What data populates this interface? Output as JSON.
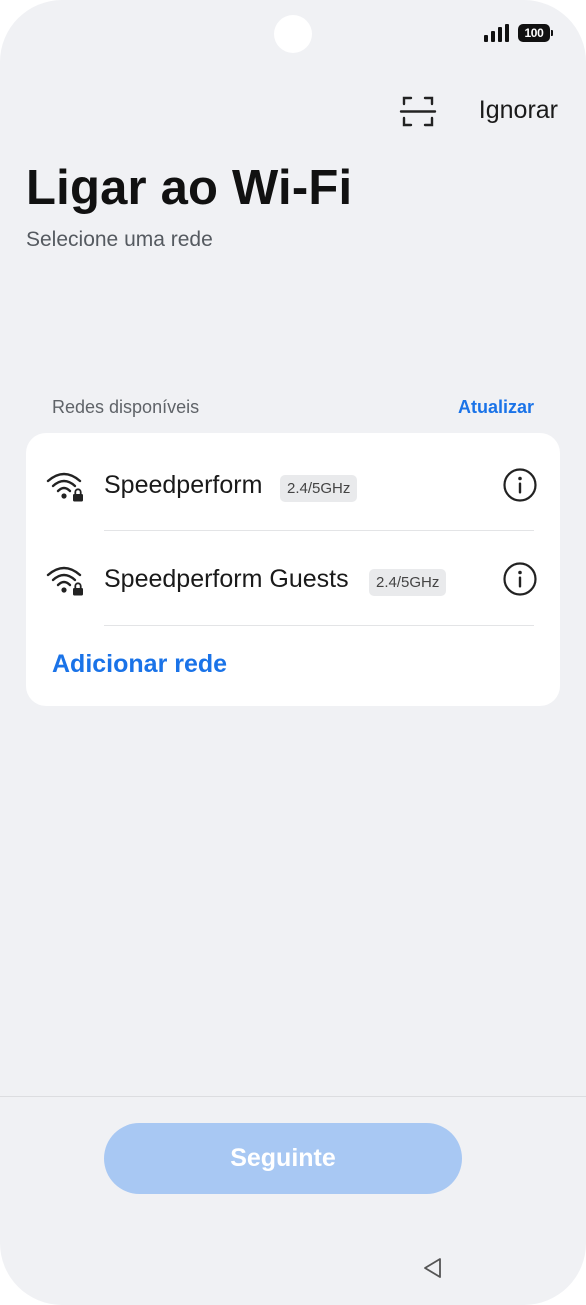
{
  "status_bar": {
    "battery_level": "100",
    "signal_icon": "signal-bars-icon"
  },
  "header": {
    "scan_icon": "qr-scan-icon",
    "skip_label": "Ignorar"
  },
  "title": "Ligar ao Wi-Fi",
  "subtitle": "Selecione uma rede",
  "networks_section": {
    "label": "Redes disponíveis",
    "refresh_label": "Atualizar",
    "items": [
      {
        "name": "Speedperform",
        "band": "2.4/5GHz",
        "secured": true,
        "icon": "wifi-lock-icon"
      },
      {
        "name": "Speedperform Guests",
        "band": "2.4/5GHz",
        "secured": true,
        "icon": "wifi-lock-icon"
      }
    ],
    "add_network_label": "Adicionar rede"
  },
  "footer": {
    "next_label": "Seguinte",
    "next_enabled": false
  },
  "nav": {
    "back_icon": "back-triangle-icon"
  },
  "colors": {
    "background": "#f0f1f4",
    "accent": "#1a73e8",
    "button_disabled": "#a8c8f3"
  }
}
